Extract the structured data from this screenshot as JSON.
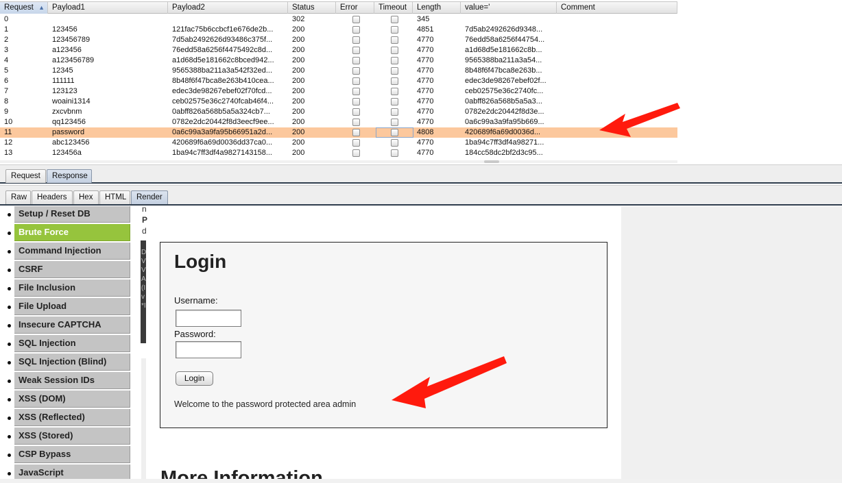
{
  "results": {
    "columns": [
      "Request",
      "Payload1",
      "Payload2",
      "Status",
      "Error",
      "Timeout",
      "Length",
      "value='",
      "Comment"
    ],
    "sort_indicator": "▲",
    "selected_request": "11",
    "rows": [
      {
        "req": "0",
        "p1": "",
        "p2": "",
        "status": "302",
        "len": "345",
        "val": ""
      },
      {
        "req": "1",
        "p1": "123456",
        "p2": "121fac75b6ccbcf1e676de2b...",
        "status": "200",
        "len": "4851",
        "val": "7d5ab2492626d9348..."
      },
      {
        "req": "2",
        "p1": "123456789",
        "p2": "7d5ab2492626d93486c375f...",
        "status": "200",
        "len": "4770",
        "val": "76edd58a6256f44754..."
      },
      {
        "req": "3",
        "p1": "a123456",
        "p2": "76edd58a6256f4475492c8d...",
        "status": "200",
        "len": "4770",
        "val": "a1d68d5e181662c8b..."
      },
      {
        "req": "4",
        "p1": "a123456789",
        "p2": "a1d68d5e181662c8bced942...",
        "status": "200",
        "len": "4770",
        "val": "9565388ba211a3a54..."
      },
      {
        "req": "5",
        "p1": "12345",
        "p2": "9565388ba211a3a542f32ed...",
        "status": "200",
        "len": "4770",
        "val": "8b48f6f47bca8e263b..."
      },
      {
        "req": "6",
        "p1": "111111",
        "p2": "8b48f6f47bca8e263b410cea...",
        "status": "200",
        "len": "4770",
        "val": "edec3de98267ebef02f..."
      },
      {
        "req": "7",
        "p1": "123123",
        "p2": "edec3de98267ebef02f70fcd...",
        "status": "200",
        "len": "4770",
        "val": "ceb02575e36c2740fc..."
      },
      {
        "req": "8",
        "p1": "woaini1314",
        "p2": "ceb02575e36c2740fcab46f4...",
        "status": "200",
        "len": "4770",
        "val": "0abff826a568b5a5a3..."
      },
      {
        "req": "9",
        "p1": "zxcvbnm",
        "p2": "0abff826a568b5a5a324cb7...",
        "status": "200",
        "len": "4770",
        "val": "0782e2dc20442f8d3e..."
      },
      {
        "req": "10",
        "p1": "qq123456",
        "p2": "0782e2dc20442f8d3eecf9ee...",
        "status": "200",
        "len": "4770",
        "val": "0a6c99a3a9fa95b669..."
      },
      {
        "req": "11",
        "p1": "password",
        "p2": "0a6c99a3a9fa95b66951a2d...",
        "status": "200",
        "len": "4808",
        "val": "420689f6a69d0036d..."
      },
      {
        "req": "12",
        "p1": "abc123456",
        "p2": "420689f6a69d0036dd37ca0...",
        "status": "200",
        "len": "4770",
        "val": "1ba94c7ff3df4a98271..."
      },
      {
        "req": "13",
        "p1": "123456a",
        "p2": "1ba94c7ff3df4a9827143158...",
        "status": "200",
        "len": "4770",
        "val": "184cc58dc2bf2d3c95..."
      }
    ]
  },
  "tabs_top": [
    "Request",
    "Response"
  ],
  "tabs_top_active": "Response",
  "tabs_view": [
    "Raw",
    "Headers",
    "Hex",
    "HTML",
    "Render"
  ],
  "tabs_view_active": "Render",
  "menu": {
    "items": [
      "Setup / Reset DB",
      "Brute Force",
      "Command Injection",
      "CSRF",
      "File Inclusion",
      "File Upload",
      "Insecure CAPTCHA",
      "SQL Injection",
      "SQL Injection (Blind)",
      "Weak Session IDs",
      "XSS (DOM)",
      "XSS (Reflected)",
      "XSS (Stored)",
      "CSP Bypass",
      "JavaScript"
    ],
    "active": "Brute Force"
  },
  "clipped": {
    "lines": [
      "n",
      "P",
      "d"
    ],
    "dark_letters": [
      "D",
      "V",
      "V",
      "A",
      "(I",
      "v",
      "*I"
    ]
  },
  "login": {
    "title": "Login",
    "username_label": "Username:",
    "password_label": "Password:",
    "username_value": "",
    "password_value": "",
    "button_label": "Login",
    "welcome": "Welcome to the password protected area admin"
  },
  "more_info_heading": "More Information",
  "colors": {
    "selected_row": "#fcc89d",
    "menu_active": "#96c43d",
    "menu_item": "#c4c4c4",
    "arrow": "#ff0000"
  }
}
